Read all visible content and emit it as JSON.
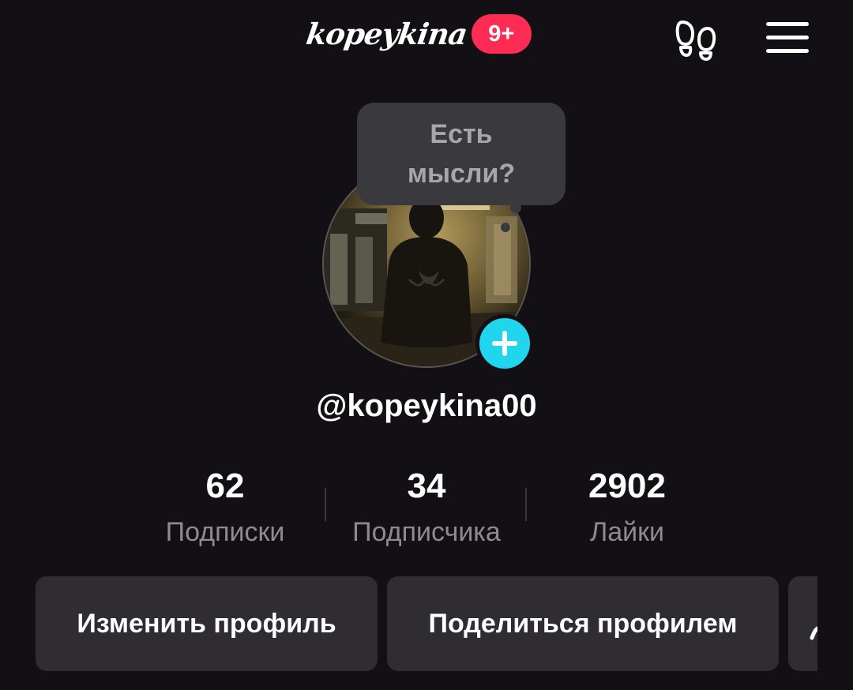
{
  "header": {
    "brand": "kopeykina",
    "notification_badge": "9+",
    "footprints_icon": "footprints-icon",
    "menu_icon": "hamburger-menu-icon"
  },
  "profile": {
    "thought_bubble": "Есть мысли?",
    "add_icon": "plus-icon",
    "username": "@kopeykina00"
  },
  "stats": [
    {
      "value": "62",
      "label": "Подписки"
    },
    {
      "value": "34",
      "label": "Подписчика"
    },
    {
      "value": "2902",
      "label": "Лайки"
    }
  ],
  "actions": {
    "edit_profile": "Изменить профиль",
    "share_profile": "Поделиться профилем",
    "add_friends_icon": "add-friend-icon"
  },
  "colors": {
    "background": "#121014",
    "badge": "#fe2c55",
    "add_button": "#20d5ec",
    "button_bg": "#2f2d32",
    "secondary_text": "#8d8b90"
  }
}
